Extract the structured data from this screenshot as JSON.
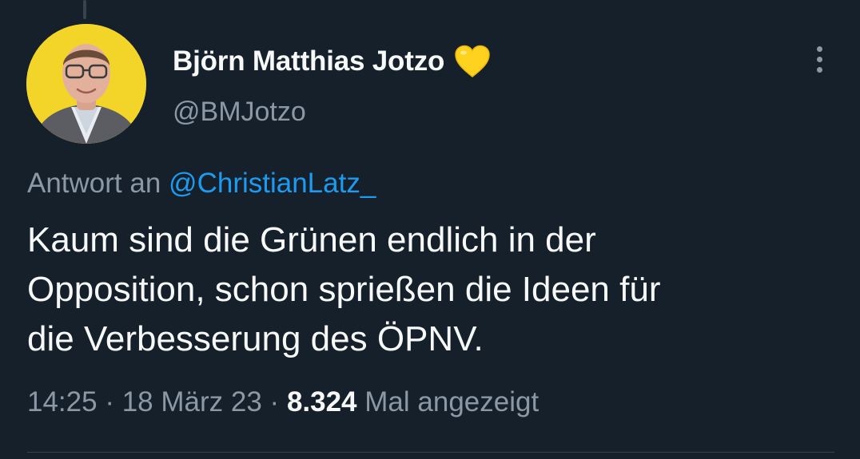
{
  "author": {
    "display_name": "Björn Matthias Jotzo",
    "badge_icon": "yellow-heart-icon",
    "handle": "@BMJotzo",
    "avatar_bg": "#f3d52a"
  },
  "reply": {
    "prefix": "Antwort an",
    "target": "@ChristianLatz_"
  },
  "tweet": {
    "lines": [
      "Kaum sind die Grünen endlich in der",
      "Opposition, schon sprießen die Ideen für",
      "die Verbesserung des ÖPNV."
    ]
  },
  "meta": {
    "time": "14:25",
    "separator": "·",
    "date": "18 März 23",
    "views": "8.324",
    "views_label": "Mal angezeigt"
  },
  "colors": {
    "background": "#15202b",
    "text": "#f7f9f9",
    "secondary": "#8b98a5",
    "link": "#1d9bf0",
    "heart": "#ffd21f"
  }
}
